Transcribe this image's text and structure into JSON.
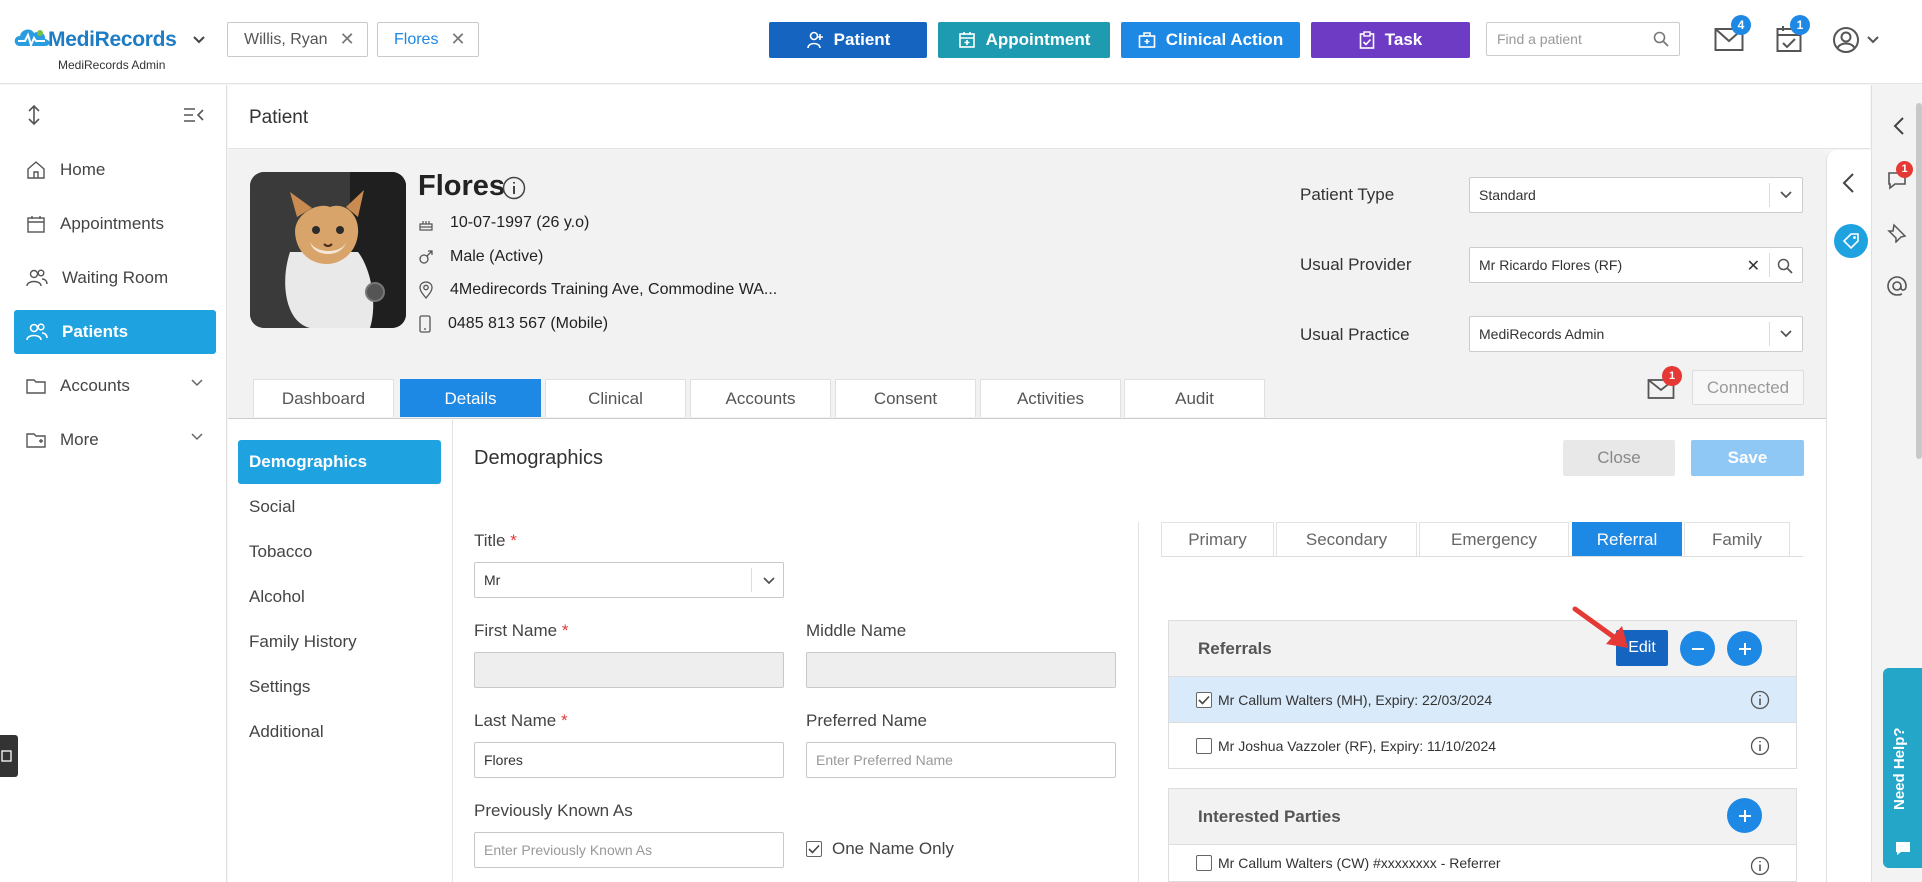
{
  "app": {
    "brand": "MediRecords",
    "subtitle": "MediRecords Admin"
  },
  "patient_chips": [
    {
      "label": "Willis, Ryan",
      "active": false
    },
    {
      "label": "Flores",
      "active": true
    }
  ],
  "top_buttons": [
    {
      "label": "Patient",
      "color": "#1565c0",
      "icon": "person-add-icon"
    },
    {
      "label": "Appointment",
      "color": "#1e9bb0",
      "icon": "calendar-add-icon"
    },
    {
      "label": "Clinical Action",
      "color": "#1e88e5",
      "icon": "medical-kit-icon"
    },
    {
      "label": "Task",
      "color": "#6e3bc4",
      "icon": "clipboard-icon"
    }
  ],
  "search": {
    "placeholder": "Find a patient"
  },
  "notifications": {
    "mail_count": "4",
    "tasks_count": "1"
  },
  "sidebar": {
    "items": [
      {
        "label": "Home",
        "icon": "home-icon"
      },
      {
        "label": "Appointments",
        "icon": "calendar-icon"
      },
      {
        "label": "Waiting Room",
        "icon": "people-icon"
      },
      {
        "label": "Patients",
        "icon": "patients-icon",
        "active": true
      },
      {
        "label": "Accounts",
        "icon": "folder-icon"
      },
      {
        "label": "More",
        "icon": "more-icon"
      }
    ]
  },
  "page": {
    "title": "Patient"
  },
  "patient": {
    "name": "Flores",
    "dob": "10-07-1997 (26 y.o)",
    "gender": "Male (Active)",
    "address": "4Medirecords Training Ave, Commodine WA...",
    "phone": "0485 813 567 (Mobile)",
    "fields": {
      "patient_type_label": "Patient Type",
      "patient_type_value": "Standard",
      "usual_provider_label": "Usual Provider",
      "usual_provider_value": "Mr Ricardo Flores (RF)",
      "usual_practice_label": "Usual Practice",
      "usual_practice_value": "MediRecords Admin"
    },
    "message_badge": "1",
    "connected_label": "Connected"
  },
  "tabs": [
    "Dashboard",
    "Details",
    "Clinical",
    "Accounts",
    "Consent",
    "Activities",
    "Audit"
  ],
  "active_tab": "Details",
  "subnav": [
    "Demographics",
    "Social",
    "Tobacco",
    "Alcohol",
    "Family History",
    "Settings",
    "Additional"
  ],
  "demographics": {
    "title": "Demographics",
    "close_label": "Close",
    "save_label": "Save",
    "title_label": "Title",
    "title_value": "Mr",
    "first_name_label": "First Name",
    "middle_name_label": "Middle Name",
    "last_name_label": "Last Name",
    "last_name_value": "Flores",
    "preferred_name_label": "Preferred Name",
    "preferred_name_placeholder": "Enter Preferred Name",
    "prev_known_label": "Previously Known As",
    "prev_known_placeholder": "Enter Previously Known As",
    "one_name_only_label": "One Name Only",
    "required_mark": "*"
  },
  "contact_tabs": [
    "Primary",
    "Secondary",
    "Emergency",
    "Referral",
    "Family"
  ],
  "active_contact_tab": "Referral",
  "referrals": {
    "title": "Referrals",
    "edit_label": "Edit",
    "items": [
      {
        "text": "Mr Callum Walters (MH), Expiry: 22/03/2024",
        "checked": true
      },
      {
        "text": "Mr Joshua Vazzoler (RF), Expiry: 11/10/2024",
        "checked": false
      }
    ]
  },
  "interested_parties": {
    "title": "Interested Parties",
    "items": [
      {
        "text": "Mr Callum Walters (CW) #xxxxxxxx - Referrer",
        "checked": false
      }
    ]
  },
  "rail": {
    "chat_badge": "1",
    "need_help_label": "Need Help?"
  }
}
